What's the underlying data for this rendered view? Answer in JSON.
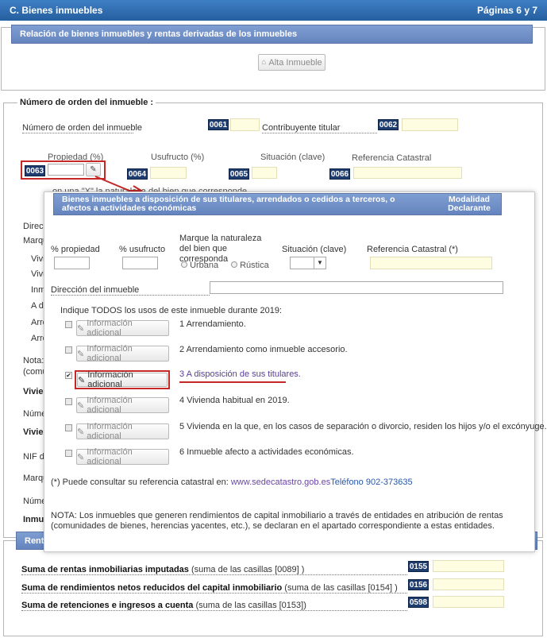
{
  "header": {
    "section": "C.  Bienes inmuebles",
    "pages": "Páginas 6 y 7"
  },
  "relacion": {
    "title": "Relación de bienes inmuebles y rentas derivadas de los inmuebles",
    "alta_button": "Alta Inmueble"
  },
  "orden": {
    "legend": "Número de orden del inmueble :",
    "numero_label": "Número de orden del inmueble",
    "code_numero": "0061",
    "contribuyente_label": "Contribuyente titular",
    "code_contribuyente": "0062",
    "propiedad_label": "Propiedad (%)",
    "code_propiedad": "0063",
    "usufructo_label": "Usufructo (%)",
    "code_usufructo": "0064",
    "situacion_label": "Situación (clave)",
    "code_situacion": "0065",
    "referencia_label": "Referencia Catastral",
    "code_referencia": "0066",
    "naturaleza_partial": "on una \"X\" la naturaleza del bien que corresponde",
    "left_fragments": [
      "Direcc",
      "Marqu",
      "Vivi",
      "Vivi",
      "Inm",
      "A di",
      "Arre",
      "Arre",
      "Nota:",
      "(comu",
      "Vivien",
      "Núme",
      "Vivien",
      "NIF de",
      "Marqu",
      "Núme",
      "Inmu"
    ]
  },
  "modal": {
    "title": "Bienes inmuebles a disposición de sus titulares, arrendados o cedidos a terceros, o afectos a actividades económicas",
    "modalidad": "Modalidad Declarante",
    "col_propiedad": "% propiedad",
    "col_usufructo": "% usufructo",
    "col_naturaleza": "Marque la naturaleza del bien que corresponda",
    "opt_urbana": "Urbana",
    "opt_rustica": "Rústica",
    "col_situacion": "Situación (clave)",
    "col_referencia": "Referencia Catastral (*)",
    "direccion_label": "Dirección del inmueble",
    "usos_label": "Indique TODOS los usos de este inmueble durante 2019:",
    "usos": [
      {
        "button": "Información adicional",
        "text": "1 Arrendamiento.",
        "checked": false
      },
      {
        "button": "Información adicional",
        "text": "2 Arrendamiento como inmueble accesorio.",
        "checked": false
      },
      {
        "button": "Información adicional",
        "text": "3 A disposición de sus titulares.",
        "checked": true
      },
      {
        "button": "Información adicional",
        "text": "4 Vivienda habitual en 2019.",
        "checked": false
      },
      {
        "button": "Información adicional",
        "text": "5 Vivienda en la que, en los casos de separación o divorcio, residen los hijos y/o el excónyuge.",
        "checked": false
      },
      {
        "button": "Información adicional",
        "text": "6 Inmueble afecto a actividades económicas.",
        "checked": false
      }
    ],
    "consulta_text": "(*) Puede consultar su referencia catastral en: ",
    "consulta_link": "www.sedecatastro.gob.es",
    "telefono": "Teléfono 902-373635",
    "nota": "NOTA: Los inmuebles que generen rendimientos de capital inmobiliario a través de entidades en atribución de rentas (comunidades de bienes, herencias yacentes, etc.), se declaran en el apartado correspondiente a estas entidades."
  },
  "rentas": {
    "title_partial": "Rent",
    "rows": [
      {
        "label_bold": "Suma de rentas inmobiliarias imputadas",
        "label_rest": " (suma de las casillas [0089] )",
        "code": "0155"
      },
      {
        "label_bold": "Suma de rendimientos netos reducidos del capital inmobiliario",
        "label_rest": " (suma de las casillas [0154] )",
        "code": "0156"
      },
      {
        "label_bold": "Suma de retenciones e ingresos a cuenta",
        "label_rest": " (suma de las casillas [0153])",
        "code": "0598"
      }
    ]
  },
  "colors": {
    "header_blue": "#2f6fb3",
    "subbar_blue": "#7393ca",
    "code_navy": "#1f3c6e",
    "highlight_red": "#c62828",
    "link_purple": "#5a3d9a"
  }
}
